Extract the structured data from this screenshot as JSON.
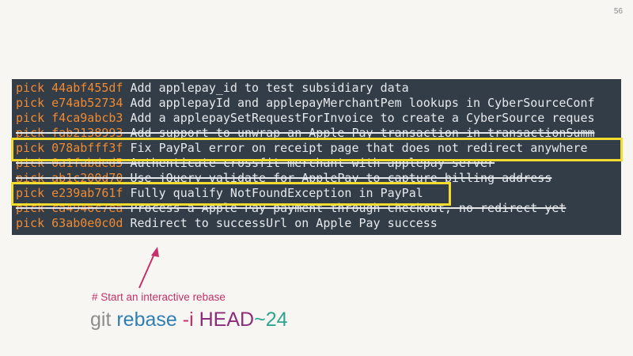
{
  "slide": {
    "number": "56"
  },
  "terminal": {
    "lines": [
      {
        "cmd": "pick",
        "sha": "44abf455df",
        "msg": "Add applepay_id to test subsidiary data"
      },
      {
        "cmd": "pick",
        "sha": "e74ab52734",
        "msg": "Add applepayId and applepayMerchantPem lookups in CyberSourceConf"
      },
      {
        "cmd": "pick",
        "sha": "f4ca9abcb3",
        "msg": "Add a applepaySetRequestForInvoice to create a CyberSource reques"
      },
      {
        "cmd": "pick",
        "sha": "fab2138993",
        "msg": "Add support to unwrap an Apple Pay transaction in transactionSumm"
      },
      {
        "cmd": "pick",
        "sha": "078abfff3f",
        "msg": "Fix PayPal error on receipt page that does not redirect anywhere"
      },
      {
        "cmd": "pick",
        "sha": "0a1fabded5",
        "msg": "Authenticate crossfit merchant with applepay server"
      },
      {
        "cmd": "pick",
        "sha": "ab1c200d70",
        "msg": "Use jQuery validate for ApplePay to capture billing address"
      },
      {
        "cmd": "pick",
        "sha": "e239ab761f",
        "msg": "Fully qualify NotFoundException in PayPal"
      },
      {
        "cmd": "pick",
        "sha": "ca4946c7ea",
        "msg": "Process a Apple Pay payment through Checkout, no redirect yet"
      },
      {
        "cmd": "pick",
        "sha": "63ab0e0c0d",
        "msg": "Redirect to successUrl on Apple Pay success"
      }
    ]
  },
  "annotation": {
    "comment": "# Start an interactive rebase",
    "command": {
      "git": "git",
      "rebase": "rebase",
      "flag": "-i",
      "head": "HEAD",
      "tilde": "~",
      "count": "24"
    }
  },
  "colors": {
    "terminal_bg": "#333d47",
    "keyword": "#f08a32",
    "text": "#e6e9ec",
    "highlight_box": "#f2dc30",
    "comment": "#c4306a"
  }
}
